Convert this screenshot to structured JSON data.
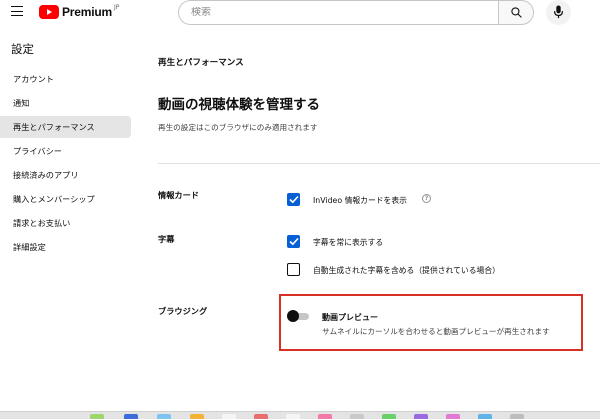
{
  "header": {
    "logo_text": "Premium",
    "logo_region": "JP",
    "search_placeholder": "検索",
    "brand_color": "#ff0000",
    "icons": [
      "menu-icon",
      "search-icon",
      "mic-icon"
    ]
  },
  "sidebar": {
    "title": "設定",
    "items": [
      {
        "label": "アカウント",
        "active": false
      },
      {
        "label": "通知",
        "active": false
      },
      {
        "label": "再生とパフォーマンス",
        "active": true
      },
      {
        "label": "プライバシー",
        "active": false
      },
      {
        "label": "接続済みのアプリ",
        "active": false
      },
      {
        "label": "購入とメンバーシップ",
        "active": false
      },
      {
        "label": "請求とお支払い",
        "active": false
      },
      {
        "label": "詳細設定",
        "active": false
      }
    ]
  },
  "main": {
    "subtitle": "再生とパフォーマンス",
    "heading": "動画の視聴体験を管理する",
    "description": "再生の設定はこのブラウザにのみ適用されます",
    "sections": {
      "info_cards": {
        "label": "情報カード",
        "options": [
          {
            "label": "InVideo 情報カードを表示",
            "checked": true,
            "help_icon": "?"
          }
        ]
      },
      "captions": {
        "label": "字幕",
        "options": [
          {
            "label": "字幕を常に表示する",
            "checked": true
          },
          {
            "label": "自動生成された字幕を含める（提供されている場合）",
            "checked": false
          }
        ]
      },
      "browsing": {
        "label": "ブラウジング",
        "toggle": {
          "title": "動画プレビュー",
          "description": "サムネイルにカーソルを合わせると動画プレビューが再生されます",
          "on": false
        }
      }
    },
    "accent_color": "#065fd4",
    "highlight_color": "#d93025"
  }
}
